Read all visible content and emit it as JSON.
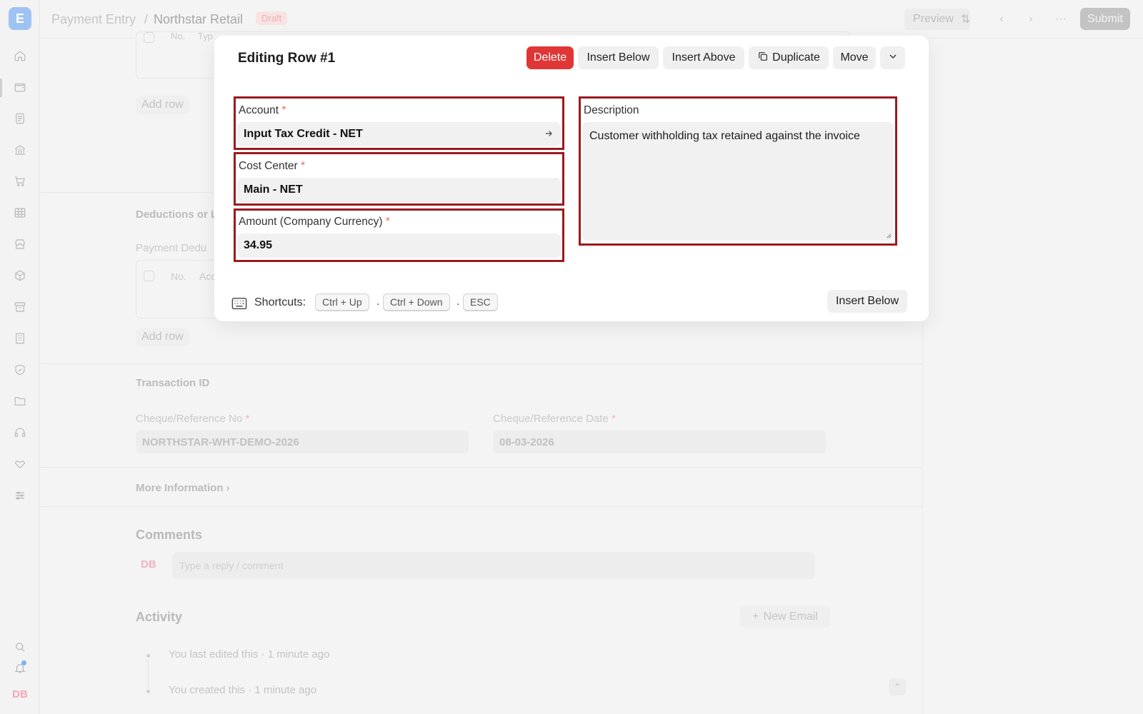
{
  "app": {
    "logo_letter": "E"
  },
  "breadcrumb": {
    "doctype": "Payment Entry",
    "separator": "/",
    "name": "Northstar Retail",
    "status": "Draft"
  },
  "topbar": {
    "preview_label": "Preview",
    "submit_label": "Submit",
    "more_label": "···"
  },
  "background": {
    "table1_header": {
      "no": "No.",
      "type": "Typ"
    },
    "add_row_label": "Add row",
    "deductions_heading": "Deductions or L",
    "payment_deductions_label": "Payment Dedu",
    "table2_header": {
      "no": "No.",
      "account": "Acc"
    },
    "transaction_heading": "Transaction ID",
    "cheque_no_label": "Cheque/Reference No",
    "cheque_no_value": "NORTHSTAR-WHT-DEMO-2026",
    "cheque_date_label": "Cheque/Reference Date",
    "cheque_date_value": "08-03-2026",
    "more_info_label": "More Information",
    "comments_heading": "Comments",
    "comment_avatar": "DB",
    "comment_placeholder": "Type a reply / comment",
    "activity_heading": "Activity",
    "new_email_label": "New Email",
    "activity_items": [
      "You last edited this · 1 minute ago",
      "You created this · 1 minute ago"
    ],
    "user_avatar": "DB",
    "required_mark": "*"
  },
  "modal": {
    "title": "Editing Row #1",
    "actions": {
      "delete": "Delete",
      "insert_below": "Insert Below",
      "insert_above": "Insert Above",
      "duplicate": "Duplicate",
      "move": "Move"
    },
    "fields": {
      "account": {
        "label": "Account",
        "value": "Input Tax Credit - NET"
      },
      "cost_center": {
        "label": "Cost Center",
        "value": "Main - NET"
      },
      "amount": {
        "label": "Amount (Company Currency)",
        "value": "34.95"
      },
      "description": {
        "label": "Description",
        "value": "Customer withholding tax retained against the invoice"
      }
    },
    "required_mark": "*",
    "shortcuts": {
      "label": "Shortcuts:",
      "keys": [
        "Ctrl + Up",
        "Ctrl + Down",
        "ESC"
      ],
      "separator": "."
    },
    "footer_insert_below": "Insert Below"
  },
  "colors": {
    "danger": "#e03636",
    "highlight_border": "#9a1b1f",
    "required": "#e66a6a"
  }
}
